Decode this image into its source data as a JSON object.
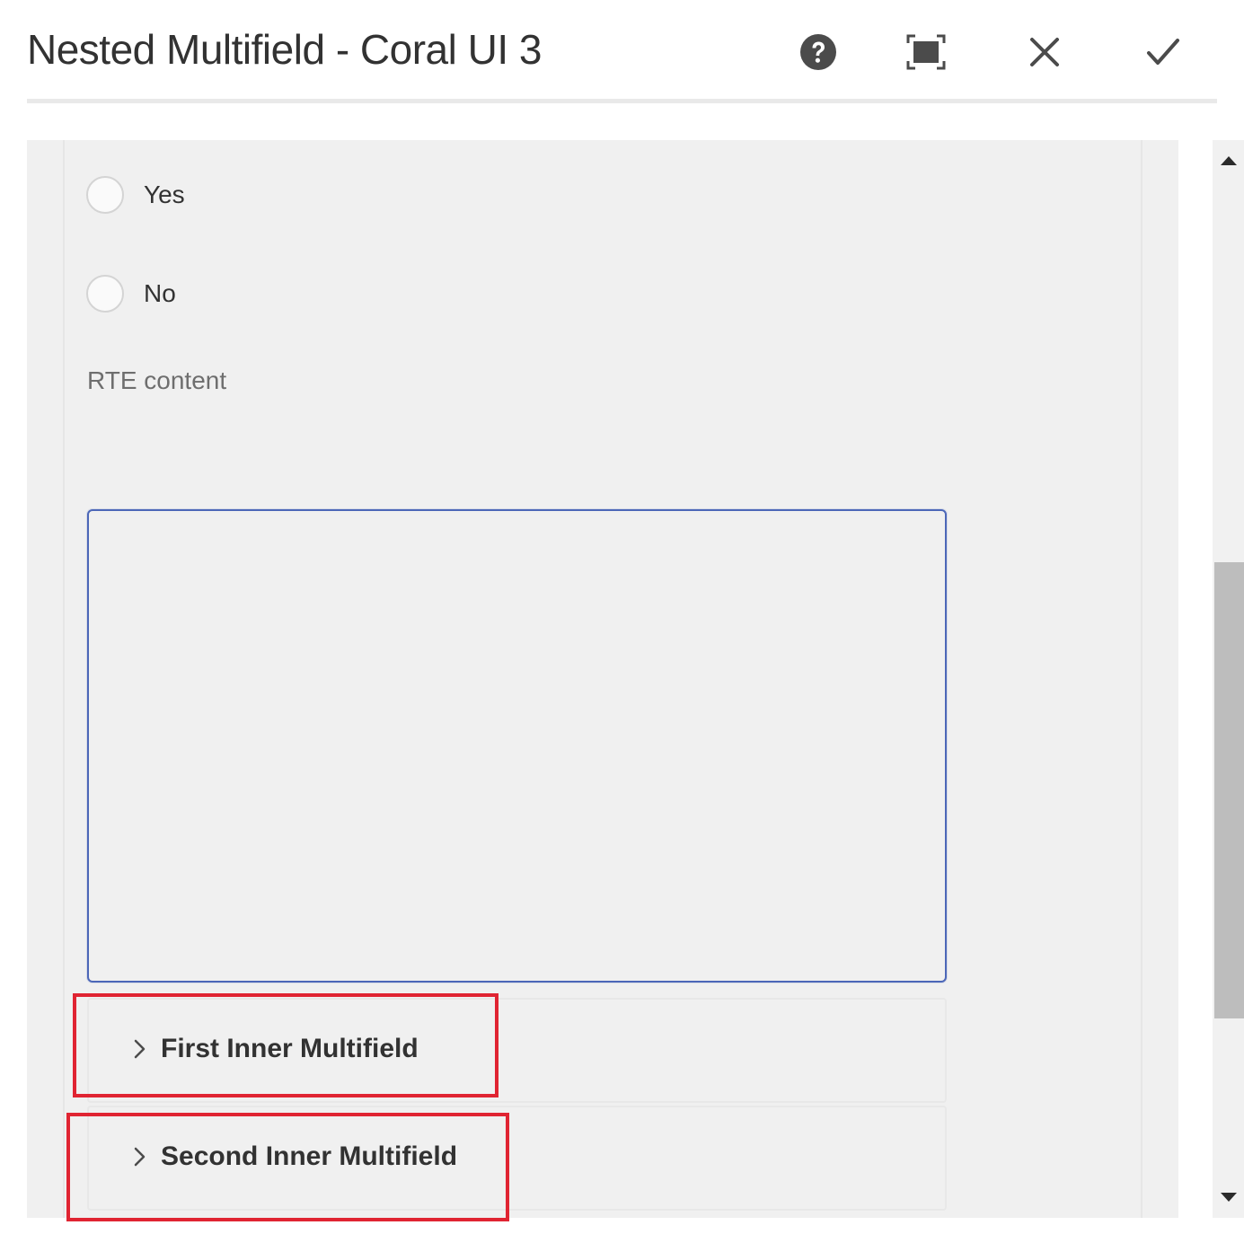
{
  "dialog": {
    "title": "Nested Multifield - Coral UI 3",
    "actions": [
      {
        "name": "help",
        "icon": "help-icon"
      },
      {
        "name": "fullscreen",
        "icon": "fullscreen-icon"
      },
      {
        "name": "cancel",
        "icon": "close-icon"
      },
      {
        "name": "done",
        "icon": "checkmark-icon"
      }
    ]
  },
  "form": {
    "radio_options": [
      {
        "label": "Yes",
        "checked": false
      },
      {
        "label": "No",
        "checked": false
      }
    ],
    "rte_label": "RTE content",
    "rte_value": "",
    "accordions": [
      {
        "label": "First Inner Multifield",
        "expanded": false
      },
      {
        "label": "Second Inner Multifield",
        "expanded": false
      }
    ]
  },
  "colors": {
    "highlight": "#e02432",
    "rte_border": "#4c67b8",
    "panel_bg": "#f0f0f0",
    "icon": "#4b4b4b"
  }
}
